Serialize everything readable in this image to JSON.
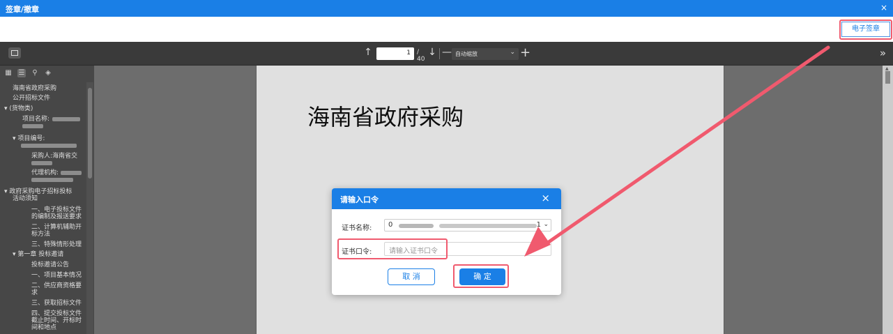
{
  "titlebar": {
    "title": "签章/撤章",
    "close": "×"
  },
  "actions": {
    "sign_label": "电子签章"
  },
  "pdf_toolbar": {
    "page_current": "1",
    "page_total": "/ 40",
    "zoom": "自动缩放",
    "prev_glyph": "↑",
    "next_glyph": "↓",
    "minus_glyph": "—",
    "plus_glyph": "+",
    "more_glyph": "»"
  },
  "outline": {
    "items": [
      "海南省政府采购",
      "公开招标文件",
      "(货物类)",
      "项目名称:",
      "项目编号:",
      "采购人:海南省交",
      "代理机构:",
      "政府采购电子招标投标",
      "活动须知",
      "一、电子投标文件",
      "的编制及报送要求",
      "二、计算机辅助开",
      "标方法",
      "三、特殊情形处理",
      "第一章 投标邀请",
      "投标邀请公告",
      "一、项目基本情况",
      "二、供应商资格要",
      "求",
      "三、获取招标文件",
      "四、提交投标文件",
      "截止时间、开标时",
      "间和地点"
    ]
  },
  "document": {
    "title": "海南省政府采购"
  },
  "dialog": {
    "title": "请输入口令",
    "close": "×",
    "cert_name_label": "证书名称:",
    "cert_name_value_prefix": "0",
    "cert_name_value_suffix": "1",
    "cert_pwd_label": "证书口令:",
    "cert_pwd_placeholder": "请输入证书口令",
    "cancel_label": "取 消",
    "ok_label": "确 定"
  },
  "colors": {
    "primary": "#1a7fe6",
    "highlight": "#f05a6e",
    "viewer_bg": "#7d7d7d",
    "toolbar_bg": "#3a3a3a"
  }
}
